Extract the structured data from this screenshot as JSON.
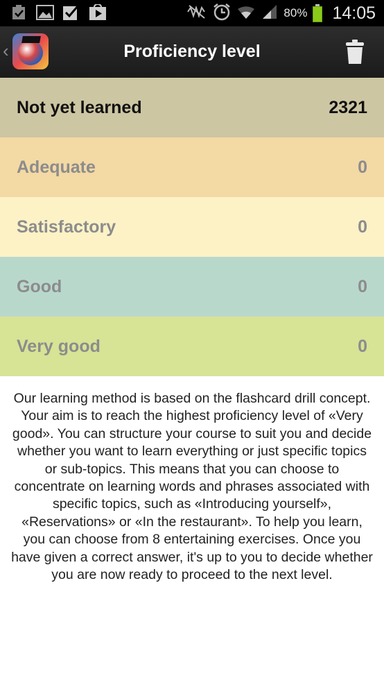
{
  "status_bar": {
    "battery_percent": "80%",
    "time": "14:05",
    "icons": [
      "task-icon",
      "image-icon",
      "checkbox-icon",
      "play-store-icon",
      "mute-icon",
      "alarm-icon",
      "wifi-icon",
      "signal-icon",
      "battery-icon"
    ]
  },
  "action_bar": {
    "title": "Proficiency level",
    "app_icon": "flags-globe-app-icon",
    "action_icon": "trash-icon"
  },
  "levels": [
    {
      "label": "Not yet learned",
      "count": "2321",
      "color": "#cdc6a2"
    },
    {
      "label": "Adequate",
      "count": "0",
      "color": "#f3d9a4"
    },
    {
      "label": "Satisfactory",
      "count": "0",
      "color": "#fdf2c6"
    },
    {
      "label": "Good",
      "count": "0",
      "color": "#b9d8cc"
    },
    {
      "label": "Very good",
      "count": "0",
      "color": "#d7e395"
    }
  ],
  "description": "Our learning method is based on the flashcard drill concept. Your aim is to reach the highest proficiency level of «Very good». You can structure your course to suit you and decide whether you want to learn everything or just specific topics or sub-topics. This means that you can choose to concentrate on learning words and phrases associated with specific topics, such as «Introducing yourself», «Reservations» or «In the restaurant». To help you learn, you can choose from 8 entertaining exercises. Once you have given a correct answer, it's up to you to decide whether you are now ready to proceed to the next level."
}
